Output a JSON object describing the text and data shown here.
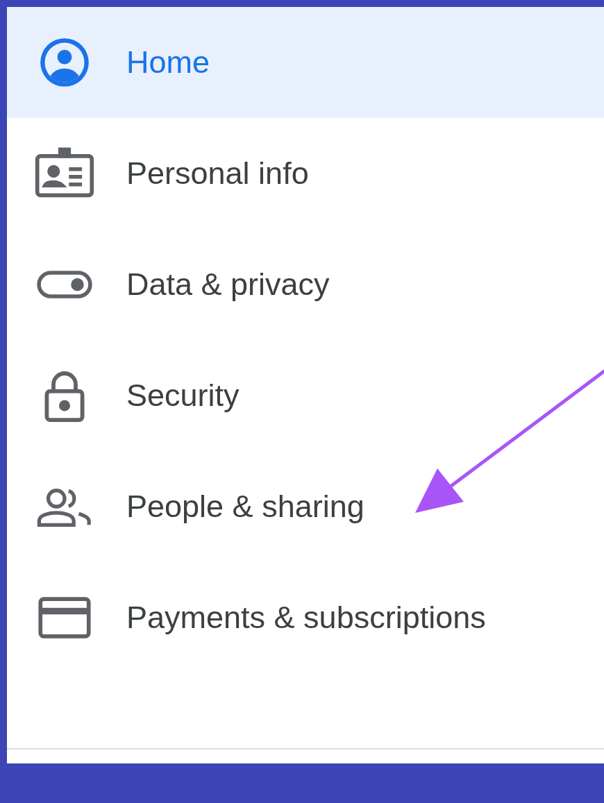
{
  "nav": {
    "items": [
      {
        "label": "Home",
        "selected": true
      },
      {
        "label": "Personal info",
        "selected": false
      },
      {
        "label": "Data & privacy",
        "selected": false
      },
      {
        "label": "Security",
        "selected": false
      },
      {
        "label": "People & sharing",
        "selected": false
      },
      {
        "label": "Payments & subscriptions",
        "selected": false
      }
    ]
  }
}
